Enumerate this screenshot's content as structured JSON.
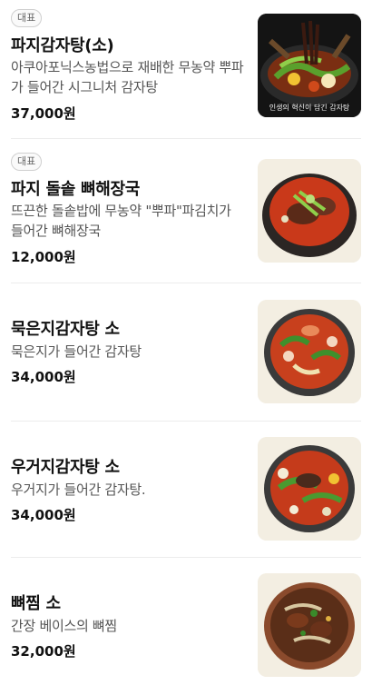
{
  "menu": {
    "items": [
      {
        "badge": "대표",
        "name": "파지감자탕(소)",
        "description": "아쿠아포닉스농법으로 재배한 무농약 뿌파가 들어간 시그니처 감자탕",
        "price": "37,000원",
        "image_caption": "인생의 혁신이 담긴 감자탕"
      },
      {
        "badge": "대표",
        "name": "파지 돌솥 뼈해장국",
        "description": "뜨끈한 돌솥밥에 무농약 \"뿌파\"파김치가 들어간 뼈해장국",
        "price": "12,000원"
      },
      {
        "name": "묵은지감자탕 소",
        "description": "묵은지가 들어간 감자탕",
        "price": "34,000원"
      },
      {
        "name": "우거지감자탕 소",
        "description": "우거지가 들어간 감자탕.",
        "price": "34,000원"
      },
      {
        "name": "뼈찜 소",
        "description": "간장 베이스의 뼈찜",
        "price": "32,000원"
      }
    ]
  }
}
